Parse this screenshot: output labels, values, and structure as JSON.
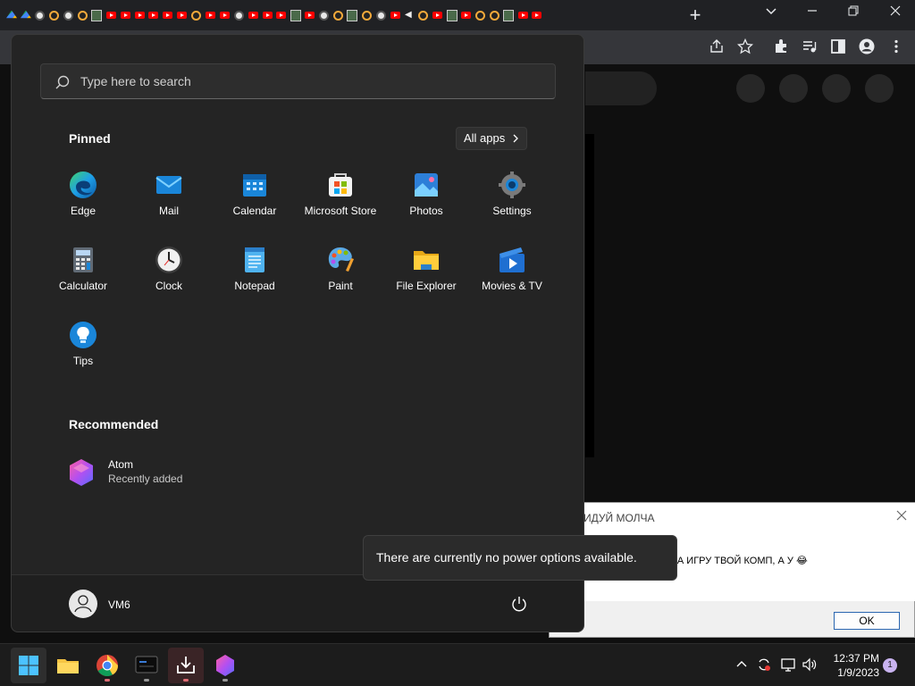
{
  "browser": {
    "tab_strip_icons": [
      "drive",
      "drive",
      "steam",
      "gear",
      "steam",
      "gear",
      "char",
      "yt",
      "yt",
      "yt",
      "yt",
      "yt",
      "yt",
      "gear",
      "yt",
      "yt",
      "steam",
      "yt",
      "yt",
      "yt",
      "char",
      "yt",
      "steam",
      "gear",
      "char",
      "gear",
      "steam",
      "yt",
      "speaker",
      "gear",
      "yt",
      "char",
      "yt",
      "gear",
      "gear",
      "char",
      "yt",
      "yt"
    ],
    "new_tab_label": "+",
    "toolbar_icons": [
      "share-icon",
      "star-icon",
      "extension-icon",
      "media-icon",
      "sidepanel-icon",
      "profile-icon",
      "menu-icon"
    ]
  },
  "start_menu": {
    "search_placeholder": "Type here to search",
    "pinned_title": "Pinned",
    "all_apps_label": "All apps",
    "pinned_apps": [
      {
        "label": "Edge",
        "icon": "edge-icon"
      },
      {
        "label": "Mail",
        "icon": "mail-icon"
      },
      {
        "label": "Calendar",
        "icon": "calendar-icon"
      },
      {
        "label": "Microsoft Store",
        "icon": "store-icon"
      },
      {
        "label": "Photos",
        "icon": "photos-icon"
      },
      {
        "label": "Settings",
        "icon": "settings-icon"
      },
      {
        "label": "Calculator",
        "icon": "calculator-icon"
      },
      {
        "label": "Clock",
        "icon": "clock-icon"
      },
      {
        "label": "Notepad",
        "icon": "notepad-icon"
      },
      {
        "label": "Paint",
        "icon": "paint-icon"
      },
      {
        "label": "File Explorer",
        "icon": "folder-icon"
      },
      {
        "label": "Movies & TV",
        "icon": "movies-icon"
      },
      {
        "label": "Tips",
        "icon": "tips-icon"
      }
    ],
    "recommended_title": "Recommended",
    "recommended": [
      {
        "name": "Atom",
        "subtitle": "Recently added",
        "icon": "atom-icon"
      }
    ],
    "user_name": "VM6"
  },
  "tooltip": {
    "text": "There are currently no power options available."
  },
  "alert": {
    "title": "ВИДУЙ МОЛЧА",
    "message": "КИЕ У МЕНЯ ЧИТЫ НА ИГРУ ТВОЙ КОМП, А У 😂",
    "ok_label": "OK"
  },
  "taskbar": {
    "apps": [
      "start-icon",
      "file-explorer-icon",
      "chrome-icon",
      "terminal-icon",
      "installer-icon",
      "atom-icon"
    ],
    "time": "12:37 PM",
    "date": "1/9/2023",
    "notification_count": "1"
  }
}
